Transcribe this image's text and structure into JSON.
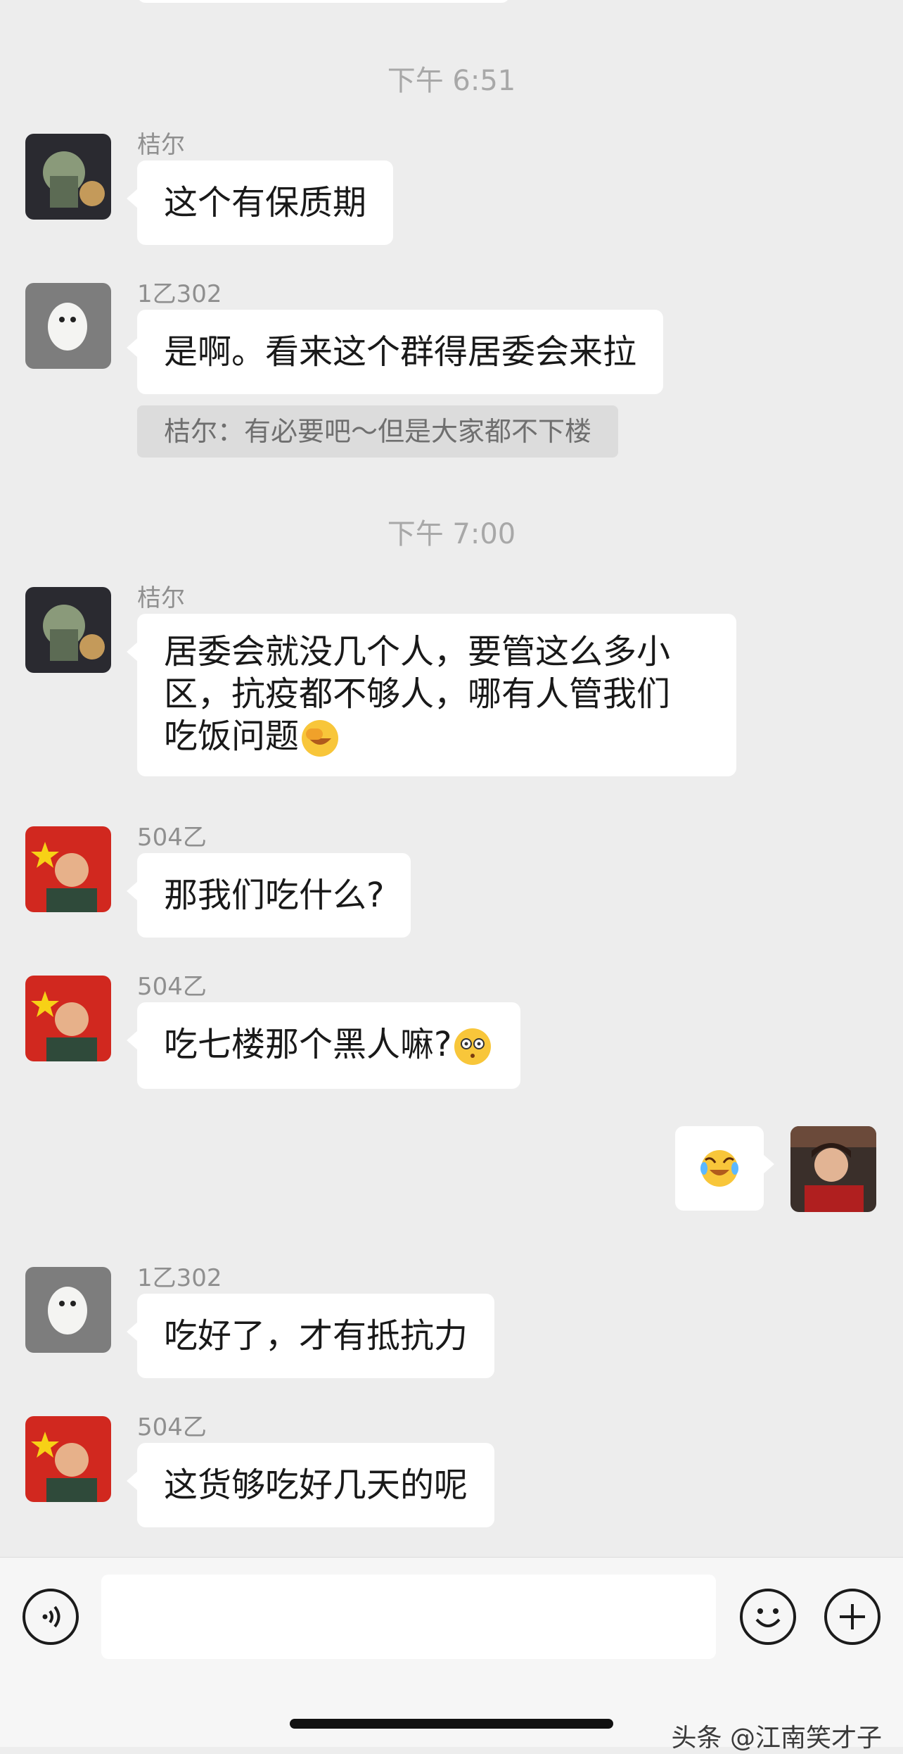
{
  "messages": [
    {
      "type": "timestamp",
      "text": "下午 6:51"
    },
    {
      "type": "received",
      "sender": "桔尔",
      "text": "这个有保质期"
    },
    {
      "type": "received",
      "sender": "1乙302",
      "text": "是啊。看来这个群得居委会来拉",
      "quote": "桔尔：有必要吧～但是大家都不下楼"
    },
    {
      "type": "timestamp",
      "text": "下午 7:00"
    },
    {
      "type": "received",
      "sender": "桔尔",
      "lines": [
        "居委会就没几个人，要管这么多小",
        "区，抗疫都不够人，哪有人管我们",
        "吃饭问题"
      ],
      "emoji": "facepalm-emoji"
    },
    {
      "type": "received",
      "sender": "504乙",
      "text": "那我们吃什么?"
    },
    {
      "type": "received",
      "sender": "504乙",
      "text": "吃七楼那个黑人嘛?",
      "emoji": "flushed-emoji"
    },
    {
      "type": "sent",
      "emoji": "crying-laughing-emoji"
    },
    {
      "type": "received",
      "sender": "1乙302",
      "text": "吃好了，才有抵抗力"
    },
    {
      "type": "received",
      "sender": "504乙",
      "text": "这货够吃好几天的呢"
    }
  ],
  "input": {
    "placeholder": ""
  },
  "watermark": "头条 @江南笑才子",
  "icons": {
    "voice": "voice-icon",
    "emoji": "emoji-icon",
    "plus": "plus-icon"
  }
}
